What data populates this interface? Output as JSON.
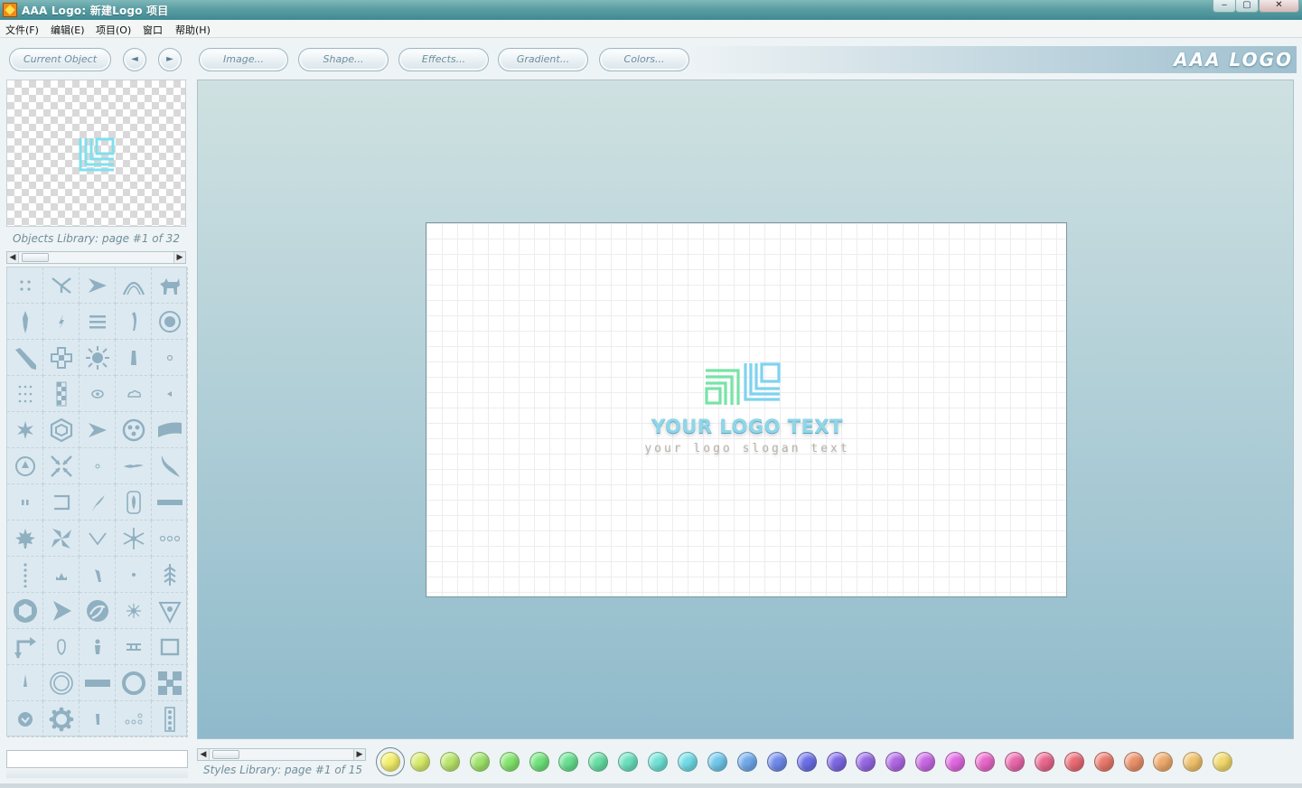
{
  "window": {
    "title": "AAA Logo: 新建Logo 项目",
    "minimize_label": "‒",
    "maximize_label": "▢",
    "close_label": "✕"
  },
  "menu": [
    "文件(F)",
    "编辑(E)",
    "项目(O)",
    "窗口",
    "帮助(H)"
  ],
  "toolbar": {
    "current_object": "Current Object",
    "prev_label": "◄",
    "next_label": "►",
    "image": "Image...",
    "shape": "Shape...",
    "effects": "Effects...",
    "gradient": "Gradient...",
    "colors": "Colors...",
    "brand": "AAA LOGO"
  },
  "objects_library": {
    "label": "Objects Library: page #1 of 32",
    "icons": [
      "dots-icon",
      "branch-icon",
      "arrow-right-icon",
      "arch-icon",
      "dog-icon",
      "figure-icon",
      "leaf-icon",
      "lines-icon",
      "feather-icon",
      "target-icon",
      "pencil-icon",
      "cross-frame-icon",
      "sun-icon",
      "bottle-icon",
      "small-circle-icon",
      "dot-grid-icon",
      "checker-icon",
      "eye-icon",
      "cloud-icon",
      "triangle-left-icon",
      "splat-icon",
      "hexagon-icon",
      "arrow-right-icon",
      "film-reel-icon",
      "wave-banner-icon",
      "badge-icon",
      "arrows-in-icon",
      "tiny-circle-icon",
      "bird-icon",
      "swoosh-icon",
      "double-bar-icon",
      "bracket-icon",
      "leaf-branch-icon",
      "flame-badge-icon",
      "bar-icon",
      "maple-leaf-icon",
      "pinwheel-icon",
      "chevron-down-icon",
      "snowflake-icon",
      "three-dots-icon",
      "vertical-dots-icon",
      "crown-icon",
      "arrow-up-icon",
      "dot-icon",
      "feather-branch-icon",
      "hexagon-badge-icon",
      "play-icon",
      "swirl-icon",
      "starburst-icon",
      "down-triangle-icon",
      "corner-arrow-icon",
      "hand-icon",
      "person-icon",
      "rails-icon",
      "square-icon",
      "spike-icon",
      "ring-icon",
      "thick-bar-icon",
      "thick-ring-icon",
      "x-blocks-icon",
      "check-circle-icon",
      "gear-icon",
      "peg-icon",
      "dots-row-icon",
      "film-strip-icon"
    ]
  },
  "canvas": {
    "logo_text": "YOUR LOGO TEXT",
    "slogan": "your logo slogan text"
  },
  "styles_library": {
    "label": "Styles Library: page #1 of 15",
    "swatches": [
      "#f2ee6a",
      "#d7ea6a",
      "#b9e56a",
      "#9fe36a",
      "#84e46e",
      "#6fe27a",
      "#66df8e",
      "#66dea4",
      "#69dfbb",
      "#6fe1d4",
      "#6fdbe6",
      "#6fc7ea",
      "#6fa8ea",
      "#6f89ea",
      "#6a6ee6",
      "#7d66e3",
      "#9566e3",
      "#ae66e3",
      "#c766e3",
      "#df66df",
      "#e866c7",
      "#e866aa",
      "#e8668e",
      "#e86a74",
      "#e8786a",
      "#ea8f6a",
      "#eda96a",
      "#efc06a",
      "#f0d86a"
    ]
  }
}
